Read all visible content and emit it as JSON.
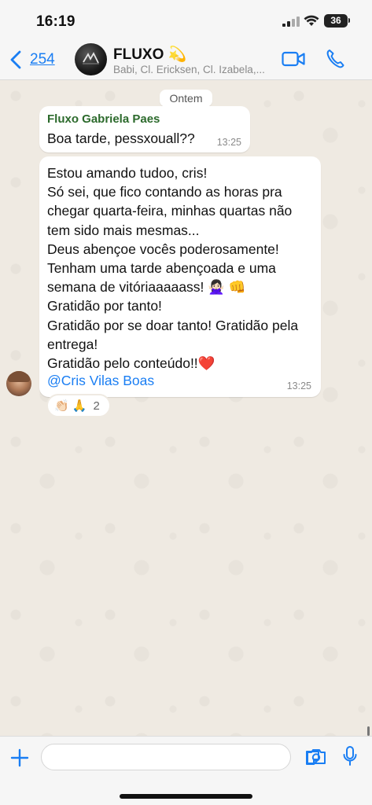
{
  "status_bar": {
    "time": "16:19",
    "battery": "36"
  },
  "header": {
    "back_count": "254",
    "group_name": "FLUXO 💫",
    "group_members": "Babi, Cl. Ericksen, Cl. Izabela,..."
  },
  "chat": {
    "date_chip": "Ontem",
    "messages": [
      {
        "sender": "Fluxo Gabriela Paes",
        "text": "Boa tarde, pessxouall??",
        "time": "13:25"
      },
      {
        "text": "Estou amando tudoo, cris!\nSó sei, que fico contando as horas pra chegar quarta-feira, minhas quartas não tem sido mais mesmas...\nDeus abençoe vocês poderosamente!\nTenham uma tarde abençoada e uma semana de vitóriaaaaass! 🙅🏻‍♀️ 👊\nGratidão por tanto!\nGratidão por se doar tanto! Gratidão pela entrega!\nGratidão pelo conteúdo!!❤️",
        "mention_at": "@",
        "mention_name": "Cris Vilas Boas",
        "time": "13:25",
        "reactions": {
          "emojis": "👏🏻 🙏",
          "count": "2"
        }
      }
    ]
  },
  "colors": {
    "accent": "#1a7ef3",
    "sender_name": "#2c6a2c",
    "chat_background": "#efeae2"
  },
  "icons": {
    "back": "chevron-left-icon",
    "video": "video-camera-icon",
    "call": "phone-icon",
    "add": "plus-icon",
    "sticker": "sticker-icon",
    "camera": "camera-icon",
    "mic": "microphone-icon"
  }
}
